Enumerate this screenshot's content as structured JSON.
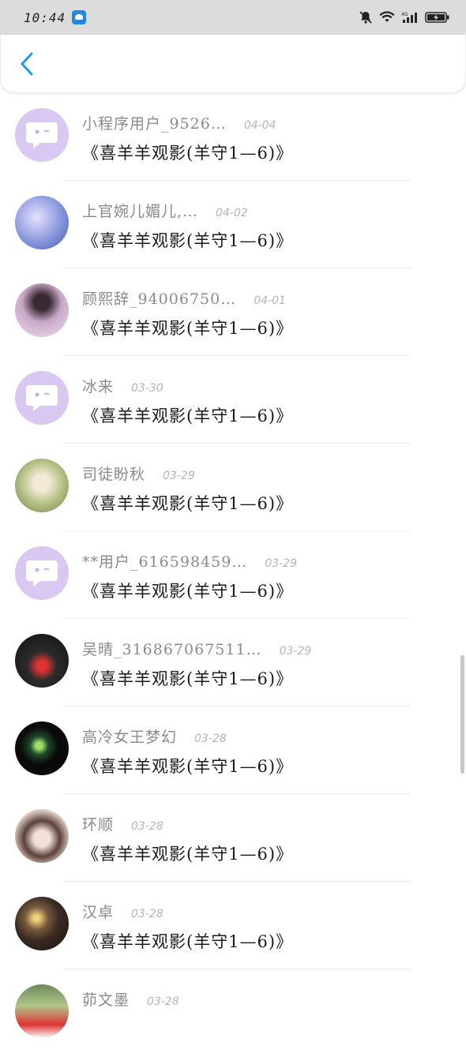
{
  "status_bar": {
    "time": "10:44"
  },
  "rows": [
    {
      "name": "小程序用户_9526…",
      "date": "04-04",
      "message": "《喜羊羊观影(羊守1—6)》",
      "avatar": "placeholder"
    },
    {
      "name": "上官婉儿媚儿,…",
      "date": "04-02",
      "message": "《喜羊羊观影(羊守1—6)》",
      "avatar": "photo",
      "avatar_color": "#7f8fd8"
    },
    {
      "name": "顾熙辞_94006750…",
      "date": "04-01",
      "message": "《喜羊羊观影(羊守1—6)》",
      "avatar": "photo",
      "avatar_color": "#c7a7c6"
    },
    {
      "name": "冰来",
      "date": "03-30",
      "message": "《喜羊羊观影(羊守1—6)》",
      "avatar": "placeholder"
    },
    {
      "name": "司徒盼秋",
      "date": "03-29",
      "message": "《喜羊羊观影(羊守1—6)》",
      "avatar": "photo",
      "avatar_color": "#b9c48a"
    },
    {
      "name": "**用户_616598459…",
      "date": "03-29",
      "message": "《喜羊羊观影(羊守1—6)》",
      "avatar": "placeholder"
    },
    {
      "name": "吴晴_316867067511…",
      "date": "03-29",
      "message": "《喜羊羊观影(羊守1—6)》",
      "avatar": "photo",
      "avatar_color": "#2b2b2b"
    },
    {
      "name": "高冷女王梦幻",
      "date": "03-28",
      "message": "《喜羊羊观影(羊守1—6)》",
      "avatar": "photo",
      "avatar_color": "#0a0a0a"
    },
    {
      "name": "环顺",
      "date": "03-28",
      "message": "《喜羊羊观影(羊守1—6)》",
      "avatar": "photo",
      "avatar_color": "#d9c7bf"
    },
    {
      "name": "汉卓",
      "date": "03-28",
      "message": "《喜羊羊观影(羊守1—6)》",
      "avatar": "photo",
      "avatar_color": "#3a2a22"
    },
    {
      "name": "茆文墨",
      "date": "03-28",
      "message": "",
      "avatar": "photo",
      "avatar_color": "#6e8a5a"
    }
  ]
}
